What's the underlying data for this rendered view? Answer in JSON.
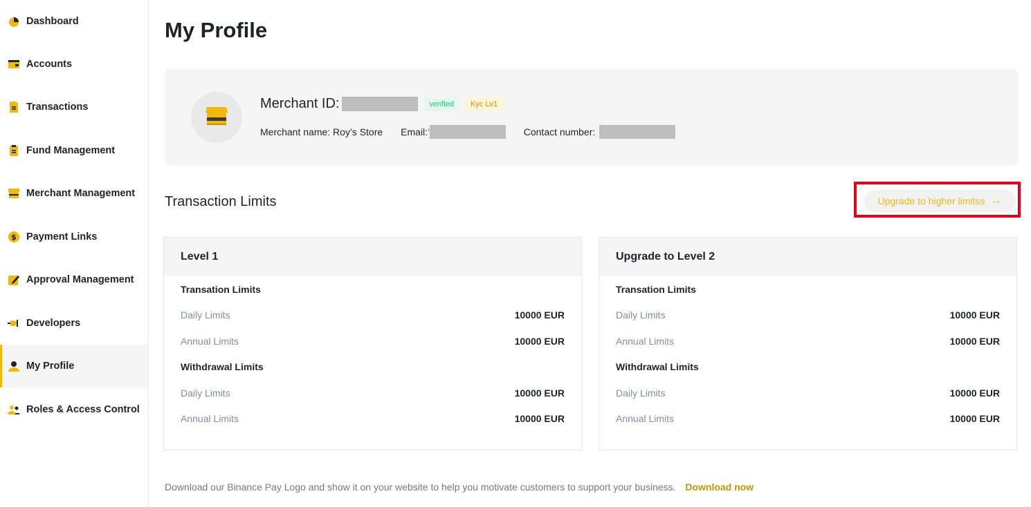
{
  "sidebar": {
    "items": [
      {
        "label": "Dashboard",
        "icon": "pie-chart-icon"
      },
      {
        "label": "Accounts",
        "icon": "wallet-icon"
      },
      {
        "label": "Transactions",
        "icon": "document-icon"
      },
      {
        "label": "Fund Management",
        "icon": "clipboard-icon"
      },
      {
        "label": "Merchant Management",
        "icon": "store-icon"
      },
      {
        "label": "Payment Links",
        "icon": "dollar-coin-icon"
      },
      {
        "label": "Approval Management",
        "icon": "edit-pencil-icon"
      },
      {
        "label": "Developers",
        "icon": "plug-icon"
      },
      {
        "label": "My Profile",
        "icon": "user-icon",
        "active": true
      },
      {
        "label": "Roles & Access Control",
        "icon": "users-icon"
      }
    ]
  },
  "page": {
    "title": "My Profile"
  },
  "profile": {
    "avatar_icon": "store-icon",
    "merchant_id_label": "Merchant ID:",
    "badge_verified": "verified",
    "badge_kyc": "Kyc Lv1",
    "merchant_name": "Merchant name: Roy’s Store",
    "email_label": "Email: ",
    "email_partial": "'",
    "contact_label": "Contact number:"
  },
  "limits": {
    "section_title": "Transaction Limits",
    "upgrade_button": "Upgrade to higher limitss",
    "upgrade_arrow": "→",
    "cards": [
      {
        "title": "Level 1",
        "transaction_group": "Transation Limits",
        "daily_label": "Daily Limits",
        "daily_value": "10000 EUR",
        "annual_label": "Annual Limits",
        "annual_value": "10000 EUR",
        "withdrawal_group": "Withdrawal Limits",
        "w_daily_label": "Daily Limits",
        "w_daily_value": "10000 EUR",
        "w_annual_label": "Annual Limits",
        "w_annual_value": "10000 EUR"
      },
      {
        "title": "Upgrade to Level 2",
        "transaction_group": "Transation Limits",
        "daily_label": "Daily Limits",
        "daily_value": "10000 EUR",
        "annual_label": "Annual Limits",
        "annual_value": "10000 EUR",
        "withdrawal_group": "Withdrawal Limits",
        "w_daily_label": "Daily Limits",
        "w_daily_value": "10000 EUR",
        "w_annual_label": "Annual Limits",
        "w_annual_value": "10000 EUR"
      }
    ]
  },
  "footer": {
    "note": "Download our Binance Pay Logo and show it on your website to help you motivate customers to support your business.",
    "link": "Download now"
  },
  "colors": {
    "accent": "#f0b90b",
    "highlight": "#e8001a",
    "verified": "#0ecb81"
  }
}
